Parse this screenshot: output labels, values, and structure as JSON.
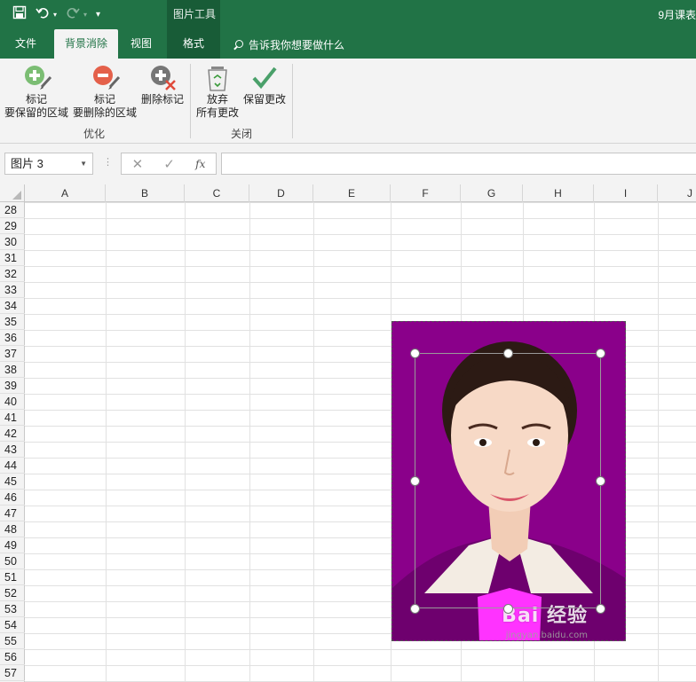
{
  "title_bar": {
    "tools_context": "图片工具",
    "document_title": "9月课表",
    "qat": {
      "save_icon": "save-icon",
      "undo_icon": "undo-icon",
      "redo_icon": "redo-icon",
      "customize_icon": "customize-qat-icon"
    }
  },
  "tabs": [
    {
      "label": "文件"
    },
    {
      "label": "背景消除",
      "active": true
    },
    {
      "label": "视图"
    },
    {
      "label": "格式"
    }
  ],
  "tell_me": {
    "text": "告诉我你想要做什么"
  },
  "ribbon": {
    "groups": [
      {
        "label": "优化",
        "buttons": [
          {
            "line1": "标记",
            "line2": "要保留的区域",
            "icon": "mark-keep-icon"
          },
          {
            "line1": "标记",
            "line2": "要删除的区域",
            "icon": "mark-remove-icon"
          },
          {
            "line1": "删除标记",
            "line2": "",
            "icon": "delete-mark-icon"
          }
        ]
      },
      {
        "label": "关闭",
        "buttons": [
          {
            "line1": "放弃",
            "line2": "所有更改",
            "icon": "discard-icon"
          },
          {
            "line1": "保留更改",
            "line2": "",
            "icon": "keep-changes-icon"
          }
        ]
      }
    ]
  },
  "formula_bar": {
    "name_box": "图片 3",
    "cancel_glyph": "✕",
    "enter_glyph": "✓",
    "fx_glyph": "fx",
    "formula": ""
  },
  "columns": [
    "A",
    "B",
    "C",
    "D",
    "E",
    "F",
    "G",
    "H",
    "I",
    "J"
  ],
  "rows": [
    "28",
    "29",
    "30",
    "31",
    "32",
    "33",
    "34",
    "35",
    "36",
    "37",
    "38",
    "39",
    "40",
    "41",
    "42",
    "43",
    "44",
    "45",
    "46",
    "47",
    "48",
    "49",
    "50",
    "51",
    "52",
    "53",
    "54",
    "55",
    "56",
    "57"
  ],
  "picture": {
    "name": "portrait-photo",
    "background_color": "#8a008a",
    "removed_area_color": "#8a008a"
  },
  "watermark": {
    "text": "Bai 经验",
    "sub": "jingyan.baidu.com"
  }
}
